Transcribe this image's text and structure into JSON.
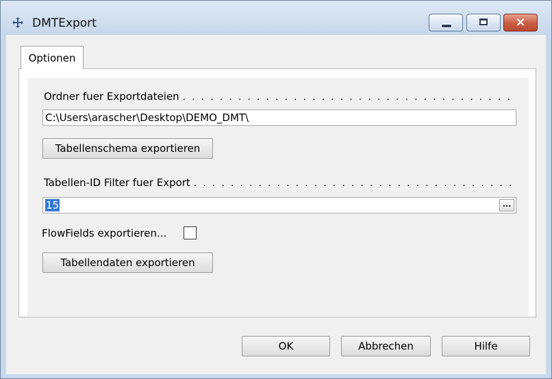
{
  "window": {
    "title": "DMTExport",
    "title_icon": "move-icon",
    "controls": {
      "minimize": "minimize-icon",
      "maximize": "maximize-icon",
      "close": "×"
    }
  },
  "tabs": [
    {
      "label": "Optionen",
      "active": true
    }
  ],
  "form": {
    "export_folder_label": "Ordner fuer Exportdateien",
    "export_folder_value": "C:\\Users\\arascher\\Desktop\\DEMO_DMT\\",
    "export_schema_button": "Tabellenschema exportieren",
    "table_filter_label": "Tabellen-ID Filter fuer Export",
    "table_filter_value": "15",
    "table_filter_lookup": "...",
    "flowfields_label": "FlowFields exportieren...",
    "flowfields_checked": false,
    "export_data_button": "Tabellendaten exportieren"
  },
  "footer": {
    "ok": "OK",
    "cancel": "Abbrechen",
    "help": "Hilfe"
  },
  "colors": {
    "title_bar": "#c9d9ec",
    "close_button": "#c85d44",
    "selection": "#3478d4"
  }
}
